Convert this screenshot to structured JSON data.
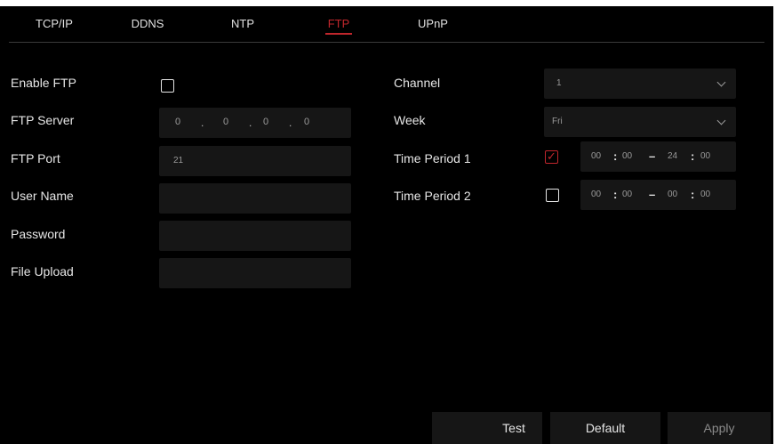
{
  "tabs": [
    {
      "label": "TCP/IP"
    },
    {
      "label": "DDNS"
    },
    {
      "label": "NTP"
    },
    {
      "label": "FTP"
    },
    {
      "label": "UPnP"
    }
  ],
  "active_tab": "FTP",
  "left": {
    "enable_ftp": {
      "label": "Enable FTP",
      "checked": false
    },
    "ftp_server": {
      "label": "FTP Server",
      "ip": [
        "0",
        "0",
        "0",
        "0"
      ],
      "separator": "."
    },
    "ftp_port": {
      "label": "FTP Port",
      "value": "21"
    },
    "user_name": {
      "label": "User Name",
      "value": ""
    },
    "password": {
      "label": "Password",
      "value": ""
    },
    "file_upload": {
      "label": "File Upload",
      "value": ""
    }
  },
  "right": {
    "channel": {
      "label": "Channel",
      "value": "1"
    },
    "week": {
      "label": "Week",
      "value": "Fri"
    },
    "time_period_1": {
      "label": "Time Period 1",
      "checked": true,
      "start_h": "00",
      "start_m": "00",
      "end_h": "24",
      "end_m": "00"
    },
    "time_period_2": {
      "label": "Time Period 2",
      "checked": false,
      "start_h": "00",
      "start_m": "00",
      "end_h": "00",
      "end_m": "00"
    },
    "time_colon": ":",
    "time_dash": "–"
  },
  "buttons": {
    "test": "Test",
    "default": "Default",
    "apply": "Apply"
  },
  "colors": {
    "accent": "#c0262c",
    "background": "#000000",
    "field": "#161616"
  }
}
